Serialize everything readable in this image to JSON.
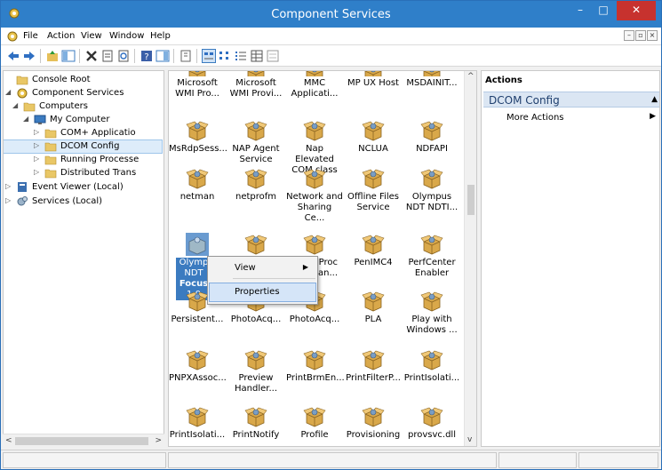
{
  "window": {
    "title": "Component Services"
  },
  "menu": {
    "items": [
      "File",
      "Action",
      "View",
      "Window",
      "Help"
    ]
  },
  "toolbar": {
    "icons": [
      "back-icon",
      "forward-icon",
      "up-folder-icon",
      "show-hide-tree-icon",
      "delete-icon",
      "properties-icon",
      "refresh-icon",
      "help-icon",
      "show-hide-action-pane-icon",
      "export-list-icon",
      "large-icons-view-icon",
      "small-icons-view-icon",
      "list-view-icon",
      "details-view-icon",
      "explore-view-icon"
    ]
  },
  "tree": {
    "items": [
      {
        "label": "Console Root",
        "icon": "folder-icon",
        "expander": ""
      },
      {
        "label": "Component Services",
        "icon": "component-services-icon",
        "expander": "◢"
      },
      {
        "label": "Computers",
        "icon": "folder-icon",
        "expander": "◢"
      },
      {
        "label": "My Computer",
        "icon": "computer-icon",
        "expander": "◢"
      },
      {
        "label": "COM+ Applicatio",
        "icon": "folder-icon",
        "expander": "▷"
      },
      {
        "label": "DCOM Config",
        "icon": "folder-icon",
        "expander": "▷"
      },
      {
        "label": "Running Processe",
        "icon": "folder-icon",
        "expander": "▷"
      },
      {
        "label": "Distributed Trans",
        "icon": "folder-icon",
        "expander": "▷"
      },
      {
        "label": "Event Viewer (Local)",
        "icon": "event-viewer-icon",
        "expander": "▷"
      },
      {
        "label": "Services (Local)",
        "icon": "services-icon",
        "expander": "▷"
      }
    ]
  },
  "center": {
    "rows": [
      [
        "Microsoft WMI Pro...",
        "Microsoft WMI Provi...",
        "MMC Applicati...",
        "MP UX Host",
        "MSDAINIT..."
      ],
      [
        "MsRdpSess...",
        "NAP Agent Service",
        "Nap Elevated COM class",
        "NCLUA",
        "NDFAPI"
      ],
      [
        "netman",
        "netprofm",
        "Network and Sharing Ce...",
        "Offline Files Service",
        "Olympus NDT NDTI..."
      ],
      [
        "Olympus NDT Focus 1.0",
        "",
        "Proc...lan...",
        "PenIMC4",
        "PerfCenter Enabler"
      ],
      [
        "Persistent...",
        "PhotoAcq...",
        "PhotoAcq...",
        "PLA",
        "Play with Windows ..."
      ],
      [
        "PNPXAssoc...",
        "Preview Handler...",
        "PrintBrmEn...",
        "PrintFilterP...",
        "PrintIsolati..."
      ],
      [
        "PrintIsolati...",
        "PrintNotify",
        "Profile",
        "Provisioning",
        "provsvc.dll"
      ]
    ],
    "selected_label_lines": [
      "Olymp",
      "NDT",
      "Focus",
      "1.0"
    ],
    "partial_label_lines": [
      "Proc",
      "lan..."
    ]
  },
  "context_menu": {
    "items": [
      {
        "label": "View",
        "submenu": "▶"
      },
      {
        "label": "Properties",
        "submenu": ""
      }
    ]
  },
  "actions": {
    "title": "Actions",
    "section": "DCOM Config",
    "links": [
      "More Actions"
    ]
  },
  "colors": {
    "titlebar": "#2f7fc9",
    "close_button": "#c7322e",
    "selection": "#3b7bc0",
    "actions_section": "#dbe6f3"
  }
}
